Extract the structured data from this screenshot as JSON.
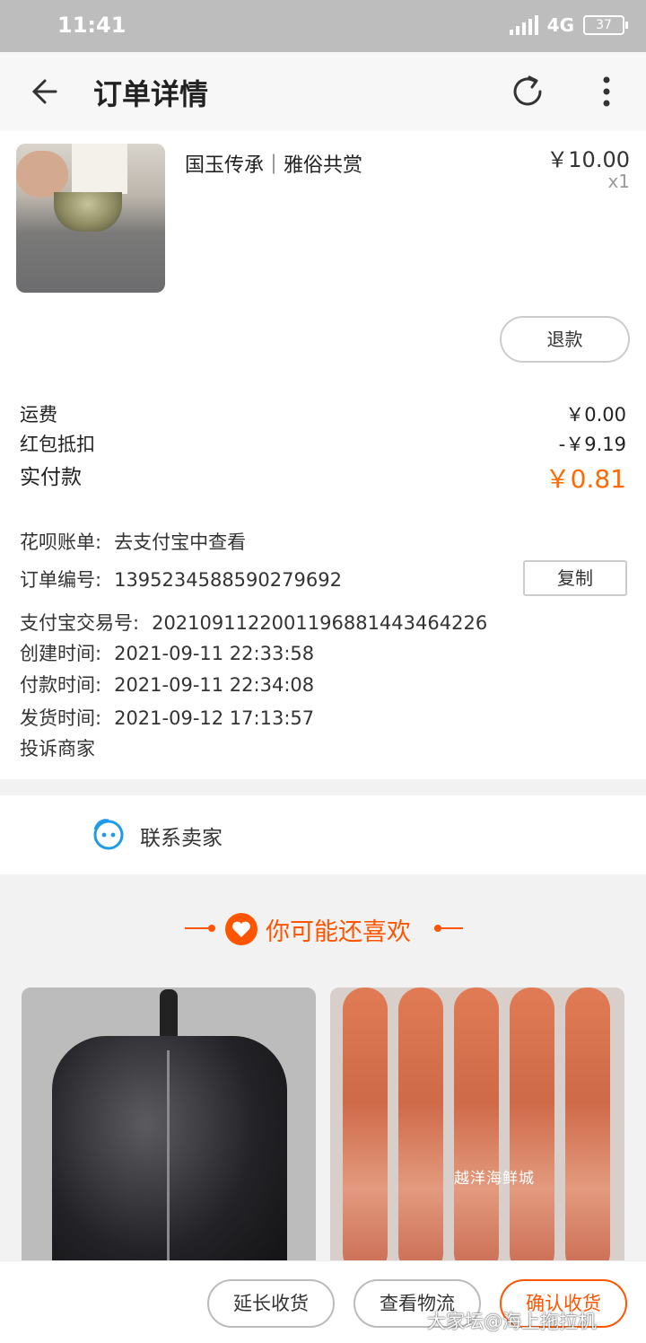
{
  "status_bar": {
    "time": "11:41",
    "network": "4G",
    "battery": "37"
  },
  "nav": {
    "title": "订单详情",
    "back_icon": "arrow-left-icon",
    "refresh_icon": "refresh-icon",
    "more_icon": "more-vertical-icon"
  },
  "order": {
    "item_name": "国玉传承｜雅俗共赏",
    "price": "￥10.00",
    "quantity": "x1",
    "refund_label": "退款",
    "fees": [
      {
        "label": "运费",
        "value": "￥0.00"
      },
      {
        "label": "红包抵扣",
        "value": "-￥9.19"
      }
    ],
    "paid_label": "实付款",
    "paid_value": "￥0.81",
    "paid_color": "#ff6a00",
    "info": {
      "huabei_label": "花呗账单:",
      "huabei_value": "去支付宝中查看",
      "order_no_label": "订单编号:",
      "order_no": "1395234588590279692",
      "copy_label": "复制",
      "alipay_label": "支付宝交易号:",
      "alipay_no": "2021091122001196881443464226",
      "created_label": "创建时间:",
      "created": "2021-09-11 22:33:58",
      "paid_time_label": "付款时间:",
      "paid_time": "2021-09-11 22:34:08",
      "shipped_label": "发货时间:",
      "shipped": "2021-09-12 17:13:57",
      "complain": "投诉商家"
    }
  },
  "contact": {
    "label": "联系卖家",
    "icon": "chat-face-icon"
  },
  "recommend": {
    "title": "你可能还喜欢",
    "accent": "#ff5500",
    "products": [
      {
        "name": "leather-jacket",
        "image_text": ""
      },
      {
        "name": "shrimp",
        "image_text": "越洋海鲜城"
      }
    ]
  },
  "bottom_actions": {
    "extend": "延长收货",
    "logistics": "查看物流",
    "confirm": "确认收货"
  },
  "watermark": "大家坛@海上拖拉机"
}
